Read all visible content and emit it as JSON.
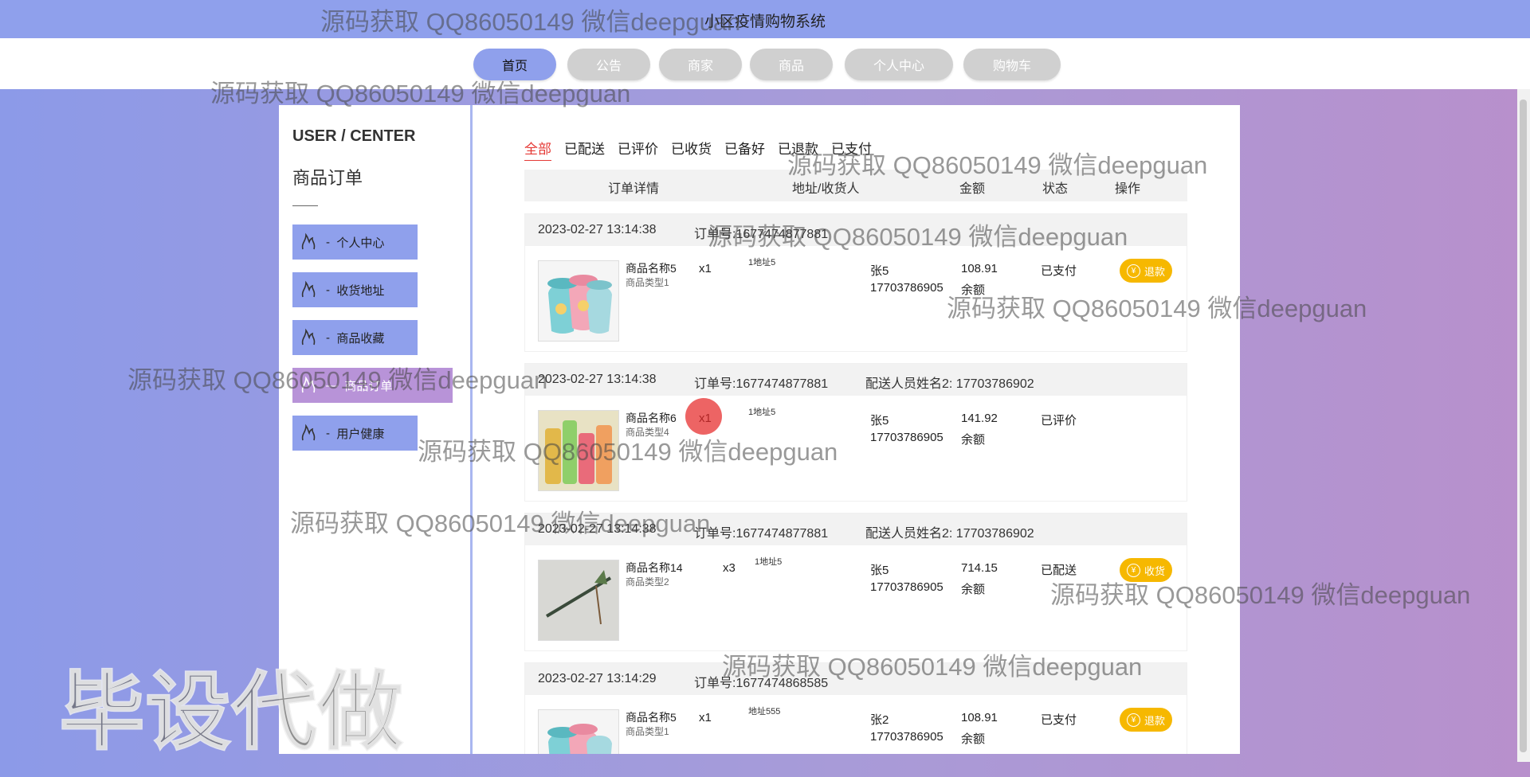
{
  "site_title": "小区疫情购物系统",
  "nav": [
    {
      "label": "首页"
    },
    {
      "label": "公告"
    },
    {
      "label": "商家"
    },
    {
      "label": "商品"
    },
    {
      "label": "个人中心"
    },
    {
      "label": "购物车"
    }
  ],
  "sidebar": {
    "title": "USER / CENTER",
    "subtitle": "商品订单",
    "items": [
      {
        "label": "个人中心"
      },
      {
        "label": "收货地址"
      },
      {
        "label": "商品收藏"
      },
      {
        "label": "商品订单"
      },
      {
        "label": "用户健康"
      }
    ]
  },
  "tabs": [
    "全部",
    "已配送",
    "已评价",
    "已收货",
    "已备好",
    "已退款",
    "已支付"
  ],
  "table_header": {
    "detail": "订单详情",
    "address": "地址/收货人",
    "amount": "金额",
    "status": "状态",
    "action": "操作"
  },
  "orders": [
    {
      "time": "2023-02-27 13:14:38",
      "order_no": "订单号:1677474877881",
      "delivery": "",
      "product_name": "商品名称5",
      "product_type": "商品类型1",
      "qty": "x1",
      "address": "1地址5",
      "receiver": "张5",
      "phone": "17703786905",
      "amount": "108.91",
      "pay_method": "余额",
      "status": "已支付",
      "action": "退款"
    },
    {
      "time": "2023-02-27 13:14:38",
      "order_no": "订单号:1677474877881",
      "delivery": "配送人员姓名2:  17703786902",
      "product_name": "商品名称6",
      "product_type": "商品类型4",
      "qty": "x1",
      "address": "1地址5",
      "receiver": "张5",
      "phone": "17703786905",
      "amount": "141.92",
      "pay_method": "余额",
      "status": "已评价",
      "action": ""
    },
    {
      "time": "2023-02-27 13:14:38",
      "order_no": "订单号:1677474877881",
      "delivery": "配送人员姓名2:  17703786902",
      "product_name": "商品名称14",
      "product_type": "商品类型2",
      "qty": "x3",
      "address": "1地址5",
      "receiver": "张5",
      "phone": "17703786905",
      "amount": "714.15",
      "pay_method": "余额",
      "status": "已配送",
      "action": "收货"
    },
    {
      "time": "2023-02-27 13:14:29",
      "order_no": "订单号:1677474868585",
      "delivery": "",
      "product_name": "商品名称5",
      "product_type": "商品类型1",
      "qty": "x1",
      "address": "地址555",
      "receiver": "张2",
      "phone": "17703786905",
      "amount": "108.91",
      "pay_method": "余额",
      "status": "已支付",
      "action": "退款"
    }
  ],
  "watermark_text": "源码获取 QQ86050149 微信deepguan",
  "overlay_text": "毕设代做",
  "colors": {
    "header": "#8fa0ec",
    "active_menu": "#b893d8",
    "accent_red": "#e53935",
    "button_yellow": "#f6b800"
  }
}
